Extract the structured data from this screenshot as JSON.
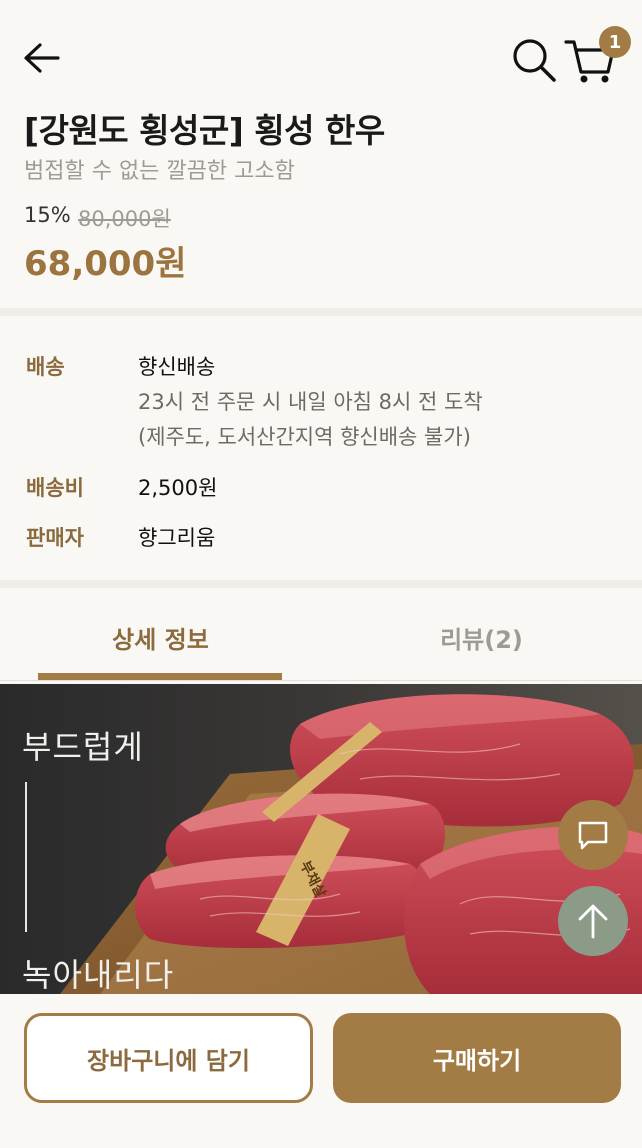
{
  "header": {
    "cart_count": "1"
  },
  "product": {
    "title": "[강원도 횡성군] 횡성 한우",
    "subtitle": "범접할 수 없는 깔끔한 고소함",
    "discount": "15%",
    "original_price": "80,000원",
    "price": "68,000원"
  },
  "info": {
    "delivery_label": "배송",
    "delivery_value": "향신배송",
    "delivery_note1": "23시 전 주문 시 내일 아침 8시 전 도착",
    "delivery_note2": "(제주도, 도서산간지역 향신배송 불가)",
    "fee_label": "배송비",
    "fee_value": "2,500원",
    "seller_label": "판매자",
    "seller_value": "향그리움"
  },
  "tabs": [
    {
      "label": "상세 정보",
      "active": true
    },
    {
      "label": "리뷰(2)",
      "active": false
    }
  ],
  "hero": {
    "text_top": "부드럽게",
    "text_bottom": "녹아내리다",
    "tag_text": "부채살"
  },
  "actions": {
    "add_to_cart": "장바구니에 담기",
    "buy": "구매하기"
  },
  "colors": {
    "accent": "#a37b45",
    "background": "#faf8f5",
    "muted": "#a09a94",
    "fab_top": "#8b9b88"
  }
}
